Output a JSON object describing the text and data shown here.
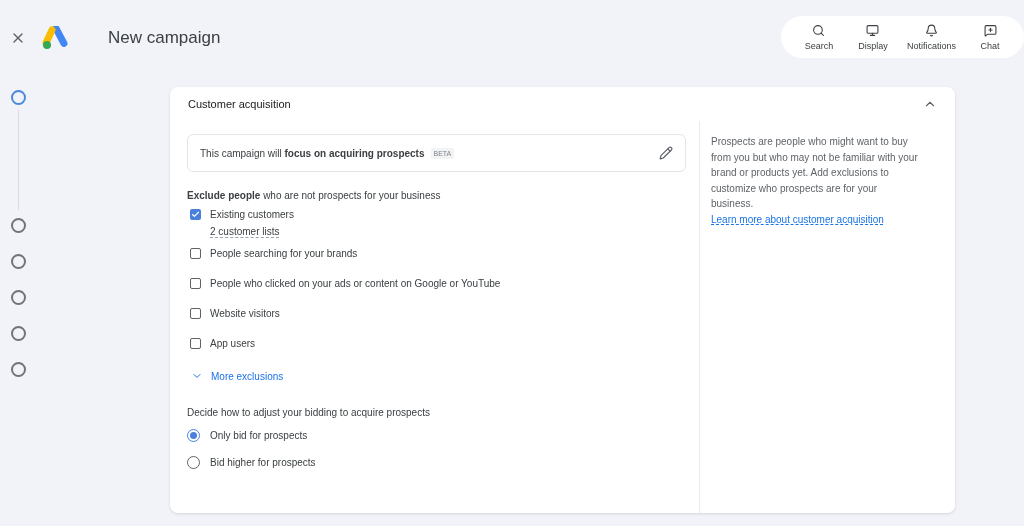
{
  "header": {
    "title": "New campaign",
    "actions": [
      {
        "kind": "search",
        "label": "Search"
      },
      {
        "kind": "display",
        "label": "Display"
      },
      {
        "kind": "notifications",
        "label": "Notifications"
      },
      {
        "kind": "chat",
        "label": "Chat"
      }
    ]
  },
  "stepper": [
    {
      "selected": true
    },
    {
      "selected": false
    },
    {
      "selected": false
    },
    {
      "selected": false
    },
    {
      "selected": false
    },
    {
      "selected": false
    }
  ],
  "card": {
    "title": "Customer acquisition",
    "expanded": true,
    "focus": {
      "text": "This campaign will **focus on acquiring prospects**",
      "badge": "BETA"
    },
    "exclude_heading": "**Exclude people** who are not prospects for your business",
    "exclusions": [
      {
        "label": "Existing customers",
        "checked": true,
        "detail": "2 customer lists"
      },
      {
        "label": "People searching for your brands",
        "checked": false
      },
      {
        "label": "People who clicked on your ads or content on Google or YouTube",
        "checked": false
      },
      {
        "label": "Website visitors",
        "checked": false
      },
      {
        "label": "App users",
        "checked": false
      }
    ],
    "more_link": "More exclusions",
    "bidding_heading": "Decide how to adjust your bidding to acquire prospects",
    "bidding_options": [
      {
        "label": "Only bid for prospects",
        "selected": true
      },
      {
        "label": "Bid higher for prospects",
        "selected": false
      }
    ],
    "help": {
      "text": "Prospects are people who might want to buy from you but who may not be familiar with your brand or products yet. Add exclusions to customize who prospects are for your business.",
      "link": "Learn more about customer acquisition"
    }
  }
}
